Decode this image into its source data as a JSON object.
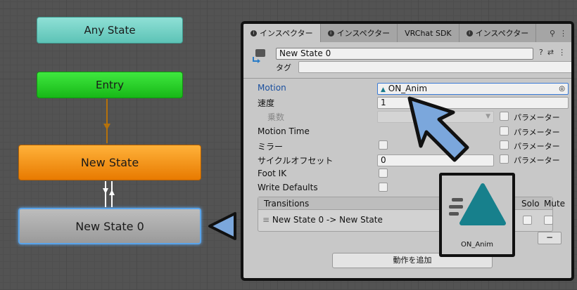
{
  "graph": {
    "any_state": "Any State",
    "entry": "Entry",
    "new_state": "New State",
    "new_state_0": "New State 0"
  },
  "tabs": [
    {
      "label": "インスペクター",
      "active": true
    },
    {
      "label": "インスペクター",
      "active": false
    },
    {
      "label": "VRChat SDK",
      "active": false
    },
    {
      "label": "インスペクター",
      "active": false
    }
  ],
  "tab_tools": {
    "lock": "🔒",
    "more": "⋮"
  },
  "header": {
    "name_value": "New State 0",
    "tag_label": "タグ",
    "icons": [
      "?",
      "⇄",
      "⋮"
    ]
  },
  "props": {
    "motion_label": "Motion",
    "motion_value": "ON_Anim",
    "speed_label": "速度",
    "speed_value": "1",
    "multiplier_label": "乗数",
    "param_label": "パラメーター",
    "motion_time_label": "Motion Time",
    "mirror_label": "ミラー",
    "cycle_offset_label": "サイクルオフセット",
    "cycle_offset_value": "0",
    "foot_ik_label": "Foot IK",
    "write_defaults_label": "Write Defaults"
  },
  "transitions": {
    "header": "Transitions",
    "solo": "Solo",
    "mute": "Mute",
    "rows": [
      "New State 0 -> New State"
    ],
    "minus": "−"
  },
  "add_behaviour": "動作を追加",
  "anim_popup": {
    "label": "ON_Anim"
  },
  "colors": {
    "selected_outline": "#5aa4ea",
    "motion_icon": "#1a7a8a",
    "arrow_blue": "#7ba7dc",
    "frame": "#111111"
  }
}
